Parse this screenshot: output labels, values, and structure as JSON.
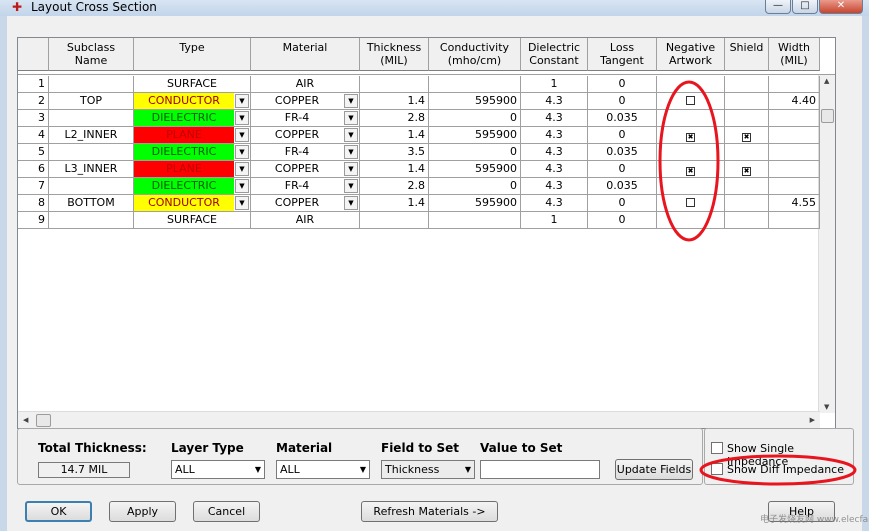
{
  "window": {
    "title": "Layout Cross Section",
    "min_icon": "—",
    "max_icon": "□",
    "close_icon": "✕"
  },
  "columns": [
    "",
    "Subclass Name",
    "Type",
    "Material",
    "Thickness\n(MIL)",
    "Conductivity\n(mho/cm)",
    "Dielectric\nConstant",
    "Loss\nTangent",
    "Negative\nArtwork",
    "Shield",
    "Width\n(MIL)"
  ],
  "rows": [
    {
      "num": "1",
      "subclass": "",
      "type": "SURFACE",
      "type_color": "",
      "type_dd": false,
      "material": "AIR",
      "mat_dd": false,
      "thickness": "",
      "conductivity": "",
      "dielectric": "1",
      "loss": "0",
      "neg": "",
      "shield": "",
      "width": ""
    },
    {
      "num": "2",
      "subclass": "TOP",
      "type": "CONDUCTOR",
      "type_color": "#ffff00",
      "type_dd": true,
      "material": "COPPER",
      "mat_dd": true,
      "thickness": "1.4",
      "conductivity": "595900",
      "dielectric": "4.3",
      "loss": "0",
      "neg": "unchecked",
      "shield": "",
      "width": "4.40"
    },
    {
      "num": "3",
      "subclass": "",
      "type": "DIELECTRIC",
      "type_color": "#00ff00",
      "type_dd": true,
      "material": "FR-4",
      "mat_dd": true,
      "thickness": "2.8",
      "conductivity": "0",
      "dielectric": "4.3",
      "loss": "0.035",
      "neg": "",
      "shield": "",
      "width": ""
    },
    {
      "num": "4",
      "subclass": "L2_INNER",
      "type": "PLANE",
      "type_color": "#ff0000",
      "type_dd": true,
      "material": "COPPER",
      "mat_dd": true,
      "thickness": "1.4",
      "conductivity": "595900",
      "dielectric": "4.3",
      "loss": "0",
      "neg": "checked",
      "shield": "checked",
      "width": ""
    },
    {
      "num": "5",
      "subclass": "",
      "type": "DIELECTRIC",
      "type_color": "#00ff00",
      "type_dd": true,
      "material": "FR-4",
      "mat_dd": true,
      "thickness": "3.5",
      "conductivity": "0",
      "dielectric": "4.3",
      "loss": "0.035",
      "neg": "",
      "shield": "",
      "width": ""
    },
    {
      "num": "6",
      "subclass": "L3_INNER",
      "type": "PLANE",
      "type_color": "#ff0000",
      "type_dd": true,
      "material": "COPPER",
      "mat_dd": true,
      "thickness": "1.4",
      "conductivity": "595900",
      "dielectric": "4.3",
      "loss": "0",
      "neg": "checked",
      "shield": "checked",
      "width": ""
    },
    {
      "num": "7",
      "subclass": "",
      "type": "DIELECTRIC",
      "type_color": "#00ff00",
      "type_dd": true,
      "material": "FR-4",
      "mat_dd": true,
      "thickness": "2.8",
      "conductivity": "0",
      "dielectric": "4.3",
      "loss": "0.035",
      "neg": "",
      "shield": "",
      "width": ""
    },
    {
      "num": "8",
      "subclass": "BOTTOM",
      "type": "CONDUCTOR",
      "type_color": "#ffff00",
      "type_dd": true,
      "material": "COPPER",
      "mat_dd": true,
      "thickness": "1.4",
      "conductivity": "595900",
      "dielectric": "4.3",
      "loss": "0",
      "neg": "unchecked",
      "shield": "",
      "width": "4.55"
    },
    {
      "num": "9",
      "subclass": "",
      "type": "SURFACE",
      "type_color": "",
      "type_dd": false,
      "material": "AIR",
      "mat_dd": false,
      "thickness": "",
      "conductivity": "",
      "dielectric": "1",
      "loss": "0",
      "neg": "",
      "shield": "",
      "width": ""
    }
  ],
  "bottom": {
    "total_thickness_label": "Total Thickness:",
    "total_thickness_value": "14.7 MIL",
    "layer_type_label": "Layer Type",
    "layer_type_value": "ALL",
    "material_label": "Material",
    "material_value": "ALL",
    "field_label": "Field to Set",
    "field_value": "Thickness",
    "value_label": "Value to Set",
    "value_input": "",
    "update_button": "Update Fields",
    "show_single": "Show Single Impedance",
    "show_diff": "Show Diff Impedance"
  },
  "buttons": {
    "ok": "OK",
    "apply": "Apply",
    "cancel": "Cancel",
    "refresh": "Refresh Materials ->",
    "help": "Help"
  },
  "annotation_color": "#e8141e",
  "watermark": "电子发烧友网 www.elecfans.com"
}
